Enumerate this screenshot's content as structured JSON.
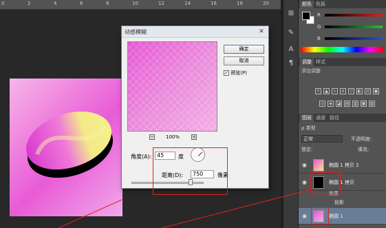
{
  "ruler": {
    "ticks": [
      "0",
      "2",
      "4",
      "6",
      "8",
      "10",
      "12",
      "14",
      "16",
      "18",
      "20"
    ]
  },
  "color_panel": {
    "tabs": [
      "颜色",
      "色板"
    ],
    "sliders": [
      {
        "label": "R",
        "color": "#e02020"
      },
      {
        "label": "G",
        "color": "#20c040"
      },
      {
        "label": "B",
        "color": "#2050e0"
      }
    ]
  },
  "adjustments": {
    "tabs": [
      "调整",
      "样式"
    ],
    "title": "添加调整"
  },
  "layers": {
    "tabs": [
      "图层",
      "通道",
      "路径"
    ],
    "filter": "ρ 类型",
    "mode": "正常",
    "opacity_label": "不透明度:",
    "lock_label": "锁定:",
    "fill_label": "填充:",
    "items": [
      {
        "name": "椭圆 1 拷贝 2"
      },
      {
        "name": "椭圆 1 拷贝"
      },
      {
        "name": "效果"
      },
      {
        "name": "投影"
      },
      {
        "name": "椭圆 1"
      }
    ]
  },
  "dialog": {
    "title": "动感模糊",
    "ok": "确定",
    "cancel": "取消",
    "preview_label": "预览(P)",
    "zoom": "100%",
    "angle_label": "角度(A):",
    "angle_value": "45",
    "angle_unit": "度",
    "distance_label": "距离(D):",
    "distance_value": "750",
    "distance_unit": "像素"
  },
  "colors": {
    "annotation": "#e02020",
    "accent": "#3c7fb1"
  }
}
